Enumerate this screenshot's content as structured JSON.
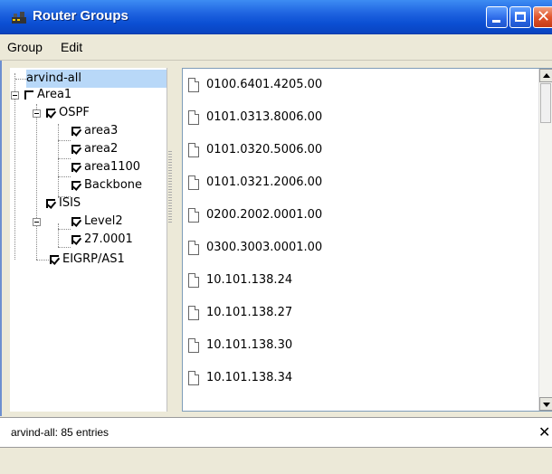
{
  "window": {
    "title": "Router Groups"
  },
  "menu": {
    "items": [
      "Group",
      "Edit"
    ]
  },
  "tree": {
    "nodes": [
      {
        "label": "arvind-all",
        "checkbox": "none",
        "selected": true
      },
      {
        "label": "Area1",
        "checkbox": "unchecked"
      },
      {
        "label": "OSPF",
        "checkbox": "checked"
      },
      {
        "label": "area3",
        "checkbox": "checked"
      },
      {
        "label": "area2",
        "checkbox": "checked"
      },
      {
        "label": "area1100",
        "checkbox": "checked"
      },
      {
        "label": "Backbone",
        "checkbox": "checked"
      },
      {
        "label": "ISIS",
        "checkbox": "checked"
      },
      {
        "label": "Level2",
        "checkbox": "checked"
      },
      {
        "label": "27.0001",
        "checkbox": "checked"
      },
      {
        "label": "EIGRP/AS1",
        "checkbox": "checked"
      }
    ]
  },
  "list": {
    "entries": [
      "0100.6401.4205.00",
      "0101.0313.8006.00",
      "0101.0320.5006.00",
      "0101.0321.2006.00",
      "0200.2002.0001.00",
      "0300.3003.0001.00",
      "10.101.138.24",
      "10.101.138.27",
      "10.101.138.30",
      "10.101.138.34"
    ]
  },
  "status": {
    "text": "arvind-all: 85 entries"
  }
}
